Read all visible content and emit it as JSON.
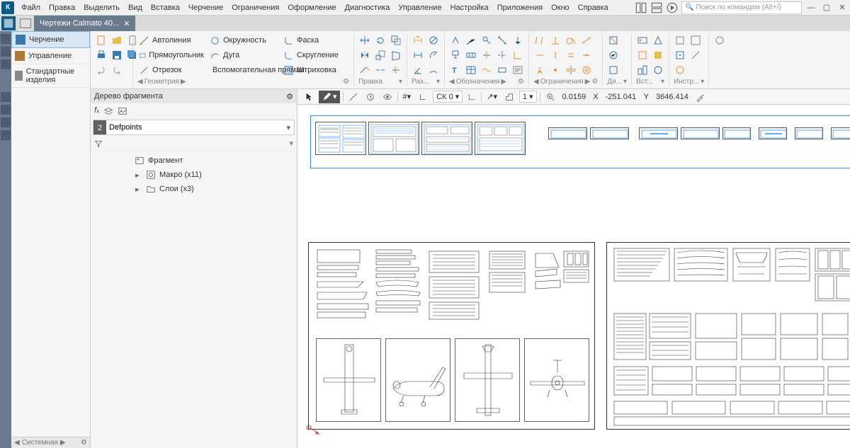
{
  "menubar": {
    "items": [
      "Файл",
      "Правка",
      "Выделить",
      "Вид",
      "Вставка",
      "Черчение",
      "Ограничения",
      "Оформление",
      "Диагностика",
      "Управление",
      "Настройка",
      "Приложения",
      "Окно",
      "Справка"
    ],
    "search_placeholder": "Поиск по командам (Alt+/)"
  },
  "doc_tab": {
    "title": "Чертежи Calmato 40..."
  },
  "sidebar": {
    "items": [
      {
        "label": "Черчение"
      },
      {
        "label": "Управление"
      },
      {
        "label": "Стандартные изделия"
      }
    ],
    "footer": "Системная"
  },
  "ribbon": {
    "file_group": "",
    "geom_label": "Геометрия",
    "edit_label": "Правка",
    "dim_label": "Раз...",
    "notation_label": "Обозначения",
    "constraint_label": "Ограничения",
    "diag_label": "Ди...",
    "insert_label": "Вст...",
    "tools_label": "Инстр...",
    "tools": {
      "autoline": "Автолиния",
      "circle": "Окружность",
      "chamfer": "Фаска",
      "rect": "Прямоугольник",
      "arc": "Дуга",
      "fillet": "Скругление",
      "segment": "Отрезок",
      "aux_line": "Вспомогательная прямая",
      "hatch": "Штриховка"
    }
  },
  "status": {
    "cs": "СК 0",
    "scale": "1",
    "step": "0.0159",
    "x_label": "X",
    "x": "-251.041",
    "y_label": "Y",
    "y": "3646.414"
  },
  "panel": {
    "title": "Дерево фрагмента",
    "layer_num": "2",
    "layer_name": "Defpoints",
    "tree": {
      "root": "Фрагмент",
      "macro": "Макро (x11)",
      "layers": "Слои (x3)"
    }
  }
}
